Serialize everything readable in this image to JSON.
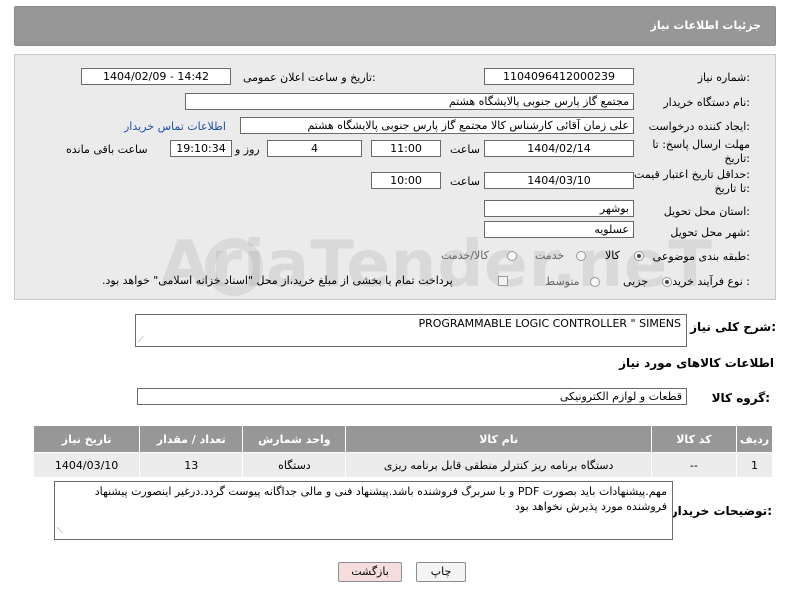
{
  "header": {
    "title": "جزئیات اطلاعات نیاز"
  },
  "form": {
    "need_number_label": "شماره نیاز:",
    "need_number": "1104096412000239",
    "announce_label": "تاریخ و ساعت اعلان عمومی:",
    "announce_value": "1404/02/09 - 14:42",
    "buyer_org_label": "نام دستگاه خریدار:",
    "buyer_org": "مجتمع گاز پارس جنوبی  پالایشگاه هشتم",
    "creator_label": "ایجاد کننده درخواست:",
    "creator": "علی زمان آقائی کارشناس کالا مجتمع گاز پارس جنوبی  پالایشگاه هشتم",
    "contact_link": "اطلاعات تماس خریدار",
    "reply_deadline_label_1": "مهلت ارسال پاسخ: تا",
    "reply_deadline_label_2": "تاریخ:",
    "reply_date": "1404/02/14",
    "time_label": "ساعت",
    "reply_time": "11:00",
    "days": "4",
    "days_label": "روز و",
    "remaining_time": "19:10:34",
    "remaining_label": "ساعت باقی مانده",
    "price_validity_label_1": "حداقل تاریخ اعتبار قیمت:",
    "price_validity_label_2": "تا تاریخ:",
    "price_date": "1404/03/10",
    "price_time": "10:00",
    "province_label": "استان محل تحویل:",
    "province": "بوشهر",
    "city_label": "شهر محل تحویل:",
    "city": "عسلویه",
    "category_label": "طبقه بندی موضوعی:",
    "category_options": [
      "کالا",
      "خدمت",
      "کالا/خدمت"
    ],
    "process_label": "نوع فرآیند خرید :",
    "process_options": [
      "جزیی",
      "متوسط"
    ],
    "treasury_note": "پرداخت تمام یا بخشی از مبلغ خرید،از محل \"اسناد خزانه اسلامی\" خواهد بود."
  },
  "description": {
    "label": "شرح کلی نیاز:",
    "value": "PROGRAMMABLE LOGIC CONTROLLER \" SIMENS"
  },
  "goods_info": {
    "section_title": "اطلاعات کالاهای مورد نیاز",
    "group_label": "گروه کالا:",
    "group_value": "قطعات و لوازم الکترونیکی"
  },
  "table": {
    "headers": [
      "ردیف",
      "کد کالا",
      "نام کالا",
      "واحد شمارش",
      "تعداد / مقدار",
      "تاریخ نیاز"
    ],
    "rows": [
      [
        "1",
        "--",
        "دستگاه برنامه ریز کنترلر منطقی قابل برنامه ریزی",
        "دستگاه",
        "13",
        "1404/03/10"
      ]
    ]
  },
  "buyer_notes": {
    "label": "توضیحات خریدار:",
    "value": "مهم.پیشنهادات باید بصورت PDF و با سربرگ فروشنده باشد.پیشنهاد فنی و مالی جداگانه پیوست گردد.درغیر اینصورت پیشنهاد فروشنده مورد پذیرش نخواهد بود"
  },
  "buttons": {
    "print": "چاپ",
    "back": "بازگشت"
  },
  "watermark": "AriaTender.neT",
  "colors": {
    "header_bg": "#979797",
    "panel_bg": "#ebebeb",
    "link": "#1f4fa8",
    "back_btn_bg": "#f7dede"
  }
}
